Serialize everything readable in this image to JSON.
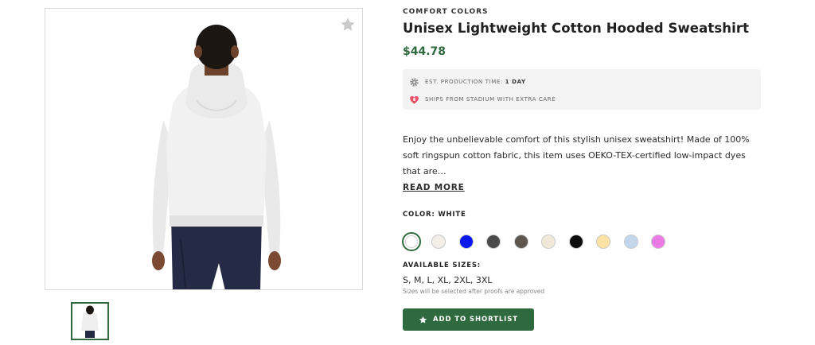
{
  "product": {
    "brand": "COMFORT COLORS",
    "title": "Unisex Lightweight Cotton Hooded Sweatshirt",
    "price": "$44.78"
  },
  "shipping": {
    "production_label": "EST. PRODUCTION TIME:",
    "production_value": "1 DAY",
    "ships_text": "SHIPS FROM STADIUM WITH EXTRA CARE"
  },
  "description": {
    "text": "Enjoy the unbelievable comfort of this stylish unisex sweatshirt! Made of 100% soft ringspun cotton fabric, this item uses OEKO-TEX-certified low-impact dyes that are…",
    "read_more": "READ MORE"
  },
  "color": {
    "label": "COLOR:",
    "selected": "WHITE",
    "swatches": [
      "#ffffff",
      "#f3efe8",
      "#0a17ee",
      "#4a4a4a",
      "#5f574d",
      "#f1e8d9",
      "#0d0d0d",
      "#fde0a3",
      "#c2d6ec",
      "#ec7ae6"
    ]
  },
  "sizes": {
    "label": "AVAILABLE SIZES:",
    "values": "S, M, L, XL, 2XL, 3XL",
    "note": "Sizes will be selected after proofs are approved"
  },
  "actions": {
    "shortlist_label": "ADD TO SHORTLIST"
  },
  "icons": {
    "favorite": "star-icon",
    "production": "gear-icon",
    "ships": "heart-badge-icon",
    "shortlist": "star-icon"
  },
  "colors": {
    "accent": "#2f6a3f",
    "ship_box_bg": "#f3f3f3",
    "heart": "#e8546a"
  }
}
